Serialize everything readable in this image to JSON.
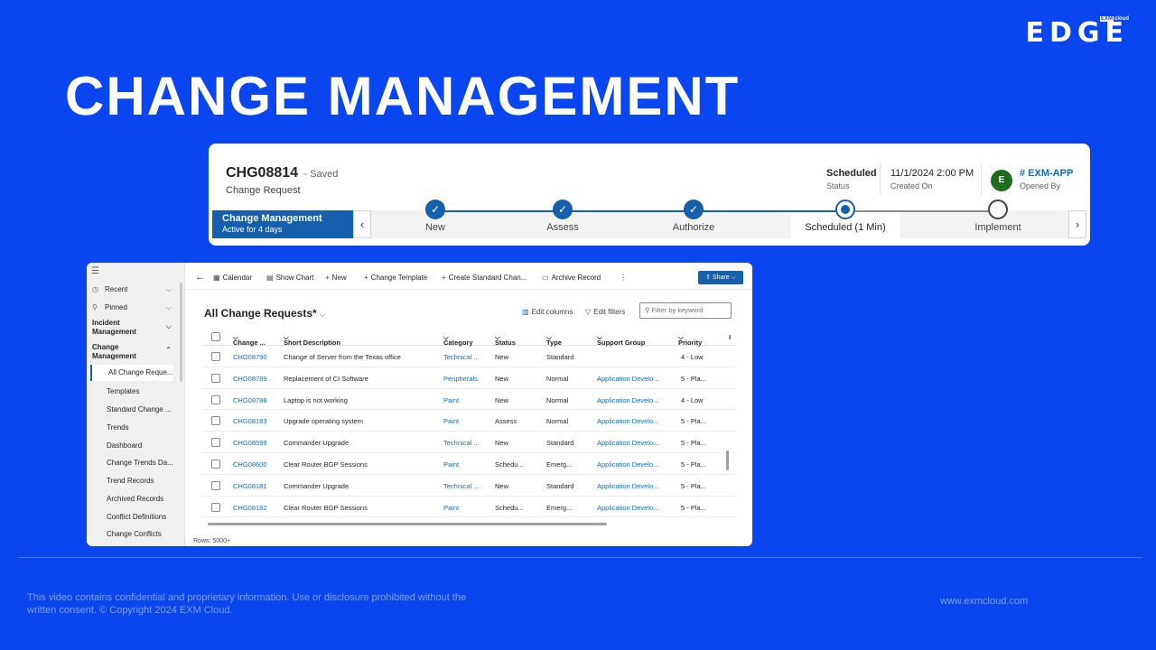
{
  "brand": {
    "small_left": "EXM",
    "small_right": "cloud",
    "main": "EDGE"
  },
  "page_title": "CHANGE MANAGEMENT",
  "record": {
    "id": "CHG08814",
    "saved": "- Saved",
    "type": "Change Request",
    "status_value": "Scheduled",
    "status_label": "Status",
    "created_value": "11/1/2024 2:00 PM",
    "created_label": "Created On",
    "avatar_initial": "E",
    "opened_by_value": "# EXM-APP",
    "opened_by_label": "Opened By"
  },
  "bpf": {
    "active_name": "Change Management",
    "active_sub": "Active for 4 days",
    "prev_icon": "chevron-left-icon",
    "next_icon": "chevron-right-icon",
    "stages": [
      {
        "label": "New",
        "state": "done"
      },
      {
        "label": "Assess",
        "state": "done"
      },
      {
        "label": "Authorize",
        "state": "done"
      },
      {
        "label": "Scheduled  (1 Min)",
        "state": "current"
      },
      {
        "label": "Implement",
        "state": "next"
      }
    ]
  },
  "sidebar": {
    "recent": "Recent",
    "pinned": "Pinned",
    "group1": "Incident Management",
    "group2": "Change Management",
    "items": [
      "All Change Reque...",
      "Templates",
      "Standard Change ...",
      "Trends",
      "Dashboard",
      "Change Trends Da...",
      "Trend Records",
      "Archived Records",
      "Conflict Definitions",
      "Change Conflicts"
    ]
  },
  "commands": {
    "calendar": "Calendar",
    "show_chart": "Show Chart",
    "new": "New",
    "change_template": "Change Template",
    "create_standard": "Create Standard Chan...",
    "archive_record": "Archive Record",
    "more": "⋮",
    "share": "Share"
  },
  "view": {
    "title": "All Change Requests*",
    "edit_columns": "Edit columns",
    "edit_filters": "Edit filters",
    "keyword_placeholder": "Filter by keyword"
  },
  "grid": {
    "headers": [
      "Change ...",
      "Short Description",
      "Category",
      "Status",
      "Type",
      "Support Group",
      "Priority",
      "I"
    ],
    "rows": [
      [
        "CHG08790",
        "Change of Server from the Texas office",
        "Technical ...",
        "New",
        "Standard",
        "",
        "4 - Low"
      ],
      [
        "CHG08789",
        "Replacement of CI Software",
        "Peripherals",
        "New",
        "Normal",
        "Application Develo...",
        "5 - Pla..."
      ],
      [
        "CHG08788",
        "Laptop is not working",
        "Paint",
        "New",
        "Normal",
        "Application Develo...",
        "4 - Low"
      ],
      [
        "CHG08183",
        "Upgrade operating system",
        "Paint",
        "Assess",
        "Normal",
        "Application Develo...",
        "5 - Pla..."
      ],
      [
        "CHG08599",
        "Commander Upgrade",
        "Technical ...",
        "New",
        "Standard",
        "Application Develo...",
        "5 - Pla..."
      ],
      [
        "CHG08600",
        "Clear Router BGP Sessions",
        "Paint",
        "Schedu...",
        "Emerg...",
        "Application Develo...",
        "5 - Pla..."
      ],
      [
        "CHG08181",
        "Commander Upgrade",
        "Technical ...",
        "New",
        "Standard",
        "Application Develo...",
        "5 - Pla..."
      ],
      [
        "CHG08182",
        "Clear Router BGP Sessions",
        "Paint",
        "Schedu...",
        "Emerg...",
        "Application Develo...",
        "5 - Pla..."
      ]
    ],
    "rows_count": "Rows: 5000+"
  },
  "footer": {
    "disclaimer": "This video contains confidential and proprietary information. Use or disclosure prohibited without the written consent. © Copyright 2024 EXM Cloud.",
    "website": "www.exmcloud.com"
  }
}
